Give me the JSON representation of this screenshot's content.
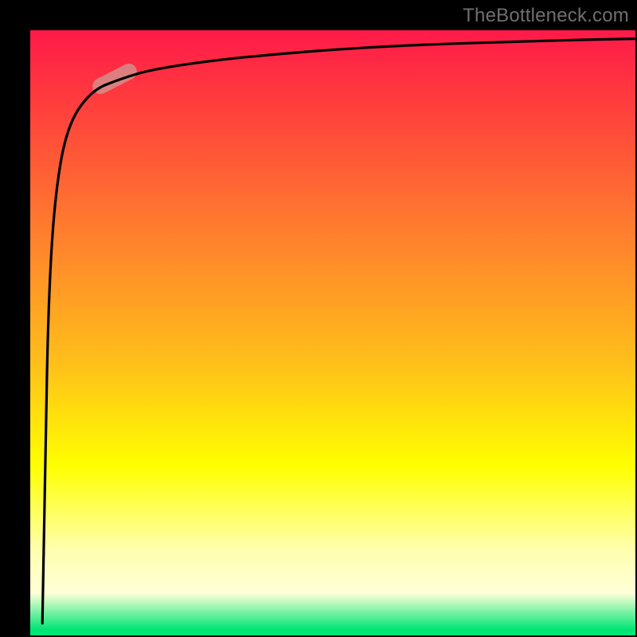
{
  "attribution": "TheBottleneck.com",
  "chart_data": {
    "type": "line",
    "title": "",
    "xlabel": "",
    "ylabel": "",
    "xlim": [
      0,
      100
    ],
    "ylim": [
      0,
      100
    ],
    "curve_points_xy": [
      [
        2,
        2
      ],
      [
        2.5,
        30
      ],
      [
        3,
        55
      ],
      [
        4,
        72
      ],
      [
        6,
        84
      ],
      [
        10,
        90
      ],
      [
        15,
        92
      ],
      [
        20,
        93.5
      ],
      [
        30,
        95
      ],
      [
        40,
        96
      ],
      [
        50,
        96.8
      ],
      [
        60,
        97.4
      ],
      [
        70,
        97.8
      ],
      [
        80,
        98.1
      ],
      [
        90,
        98.4
      ],
      [
        100,
        98.6
      ]
    ],
    "highlight_segment": {
      "x": 14,
      "y": 92,
      "rotation_deg": -27
    }
  },
  "colors": {
    "background": "#000000",
    "attribution_text": "#6f6f6f",
    "curve": "#000000",
    "highlight_pill": "#d68d8a",
    "gradient_stops": [
      "#ff1a49",
      "#ff7a2f",
      "#ffff00",
      "#ffffd8",
      "#00e676"
    ]
  }
}
